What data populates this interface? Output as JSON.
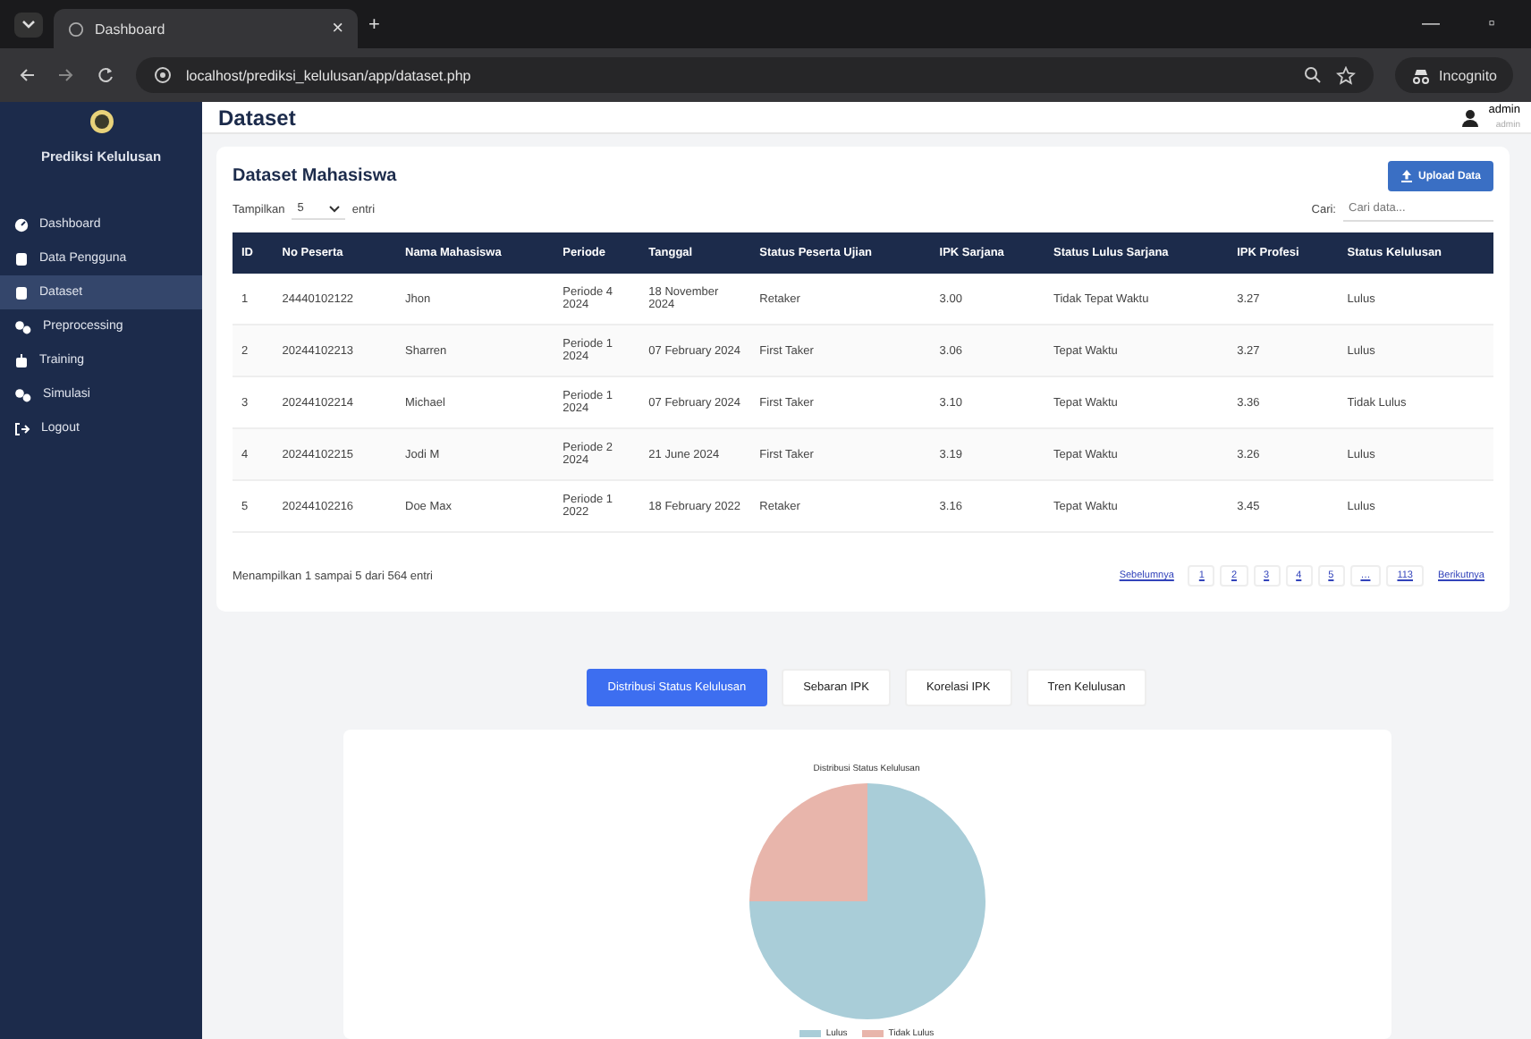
{
  "browser": {
    "tab_title": "Dashboard",
    "tab_close": "×",
    "new_tab": "+",
    "url": "localhost/prediksi_kelulusan/app/dataset.php",
    "incognito": "Incognito",
    "window_controls": [
      "—",
      "▫"
    ]
  },
  "sidebar": {
    "brand": "Prediksi Kelulusan",
    "items": [
      {
        "label": "Dashboard",
        "kind": "gauge",
        "selected": false
      },
      {
        "label": "Data Pengguna",
        "kind": "db",
        "selected": false
      },
      {
        "label": "Dataset",
        "kind": "db",
        "selected": true
      },
      {
        "label": "Preprocessing",
        "kind": "gears",
        "selected": false
      },
      {
        "label": "Training",
        "kind": "robot",
        "selected": false
      },
      {
        "label": "Simulasi",
        "kind": "gears",
        "selected": false
      },
      {
        "label": "Logout",
        "kind": "logout",
        "selected": false
      }
    ]
  },
  "header": {
    "title": "Dataset",
    "user": "admin",
    "role": "admin"
  },
  "card": {
    "title": "Dataset Mahasiswa",
    "upload": "Upload Data",
    "show_label": "Tampilkan",
    "show_value": "5",
    "entries_label": "entri",
    "search_label": "Cari:",
    "search_placeholder": "Cari data...",
    "columns": [
      "ID",
      "No Peserta",
      "Nama Mahasiswa",
      "Periode",
      "Tanggal",
      "Status Peserta Ujian",
      "IPK Sarjana",
      "Status Lulus Sarjana",
      "IPK Profesi",
      "Status Kelulusan"
    ],
    "rows": [
      [
        "1",
        "24440102122",
        "Jhon",
        "Periode 4 2024",
        "18 November 2024",
        "Retaker",
        "3.00",
        "Tidak Tepat Waktu",
        "3.27",
        "Lulus"
      ],
      [
        "2",
        "20244102213",
        "Sharren",
        "Periode 1 2024",
        "07 February 2024",
        "First Taker",
        "3.06",
        "Tepat Waktu",
        "3.27",
        "Lulus"
      ],
      [
        "3",
        "20244102214",
        "Michael",
        "Periode 1 2024",
        "07 February 2024",
        "First Taker",
        "3.10",
        "Tepat Waktu",
        "3.36",
        "Tidak Lulus"
      ],
      [
        "4",
        "20244102215",
        "Jodi M",
        "Periode 2 2024",
        "21 June 2024",
        "First Taker",
        "3.19",
        "Tepat Waktu",
        "3.26",
        "Lulus"
      ],
      [
        "5",
        "20244102216",
        "Doe Max",
        "Periode 1 2022",
        "18 February 2022",
        "Retaker",
        "3.16",
        "Tepat Waktu",
        "3.45",
        "Lulus"
      ]
    ],
    "info": "Menampilkan 1 sampai 5 dari 564 entri",
    "pagination": [
      "Sebelumnya",
      "1",
      "2",
      "3",
      "4",
      "5",
      "…",
      "113",
      "Berikutnya"
    ]
  },
  "chart_tabs": [
    {
      "label": "Distribusi Status Kelulusan",
      "selected": true
    },
    {
      "label": "Sebaran IPK",
      "selected": false
    },
    {
      "label": "Korelasi IPK",
      "selected": false
    },
    {
      "label": "Tren Kelulusan",
      "selected": false
    }
  ],
  "chart": {
    "title": "Distribusi Status Kelulusan",
    "legend": [
      {
        "label": "Lulus",
        "color": "#a9cdd8"
      },
      {
        "label": "Tidak Lulus",
        "color": "#e8b5ab"
      }
    ]
  }
}
